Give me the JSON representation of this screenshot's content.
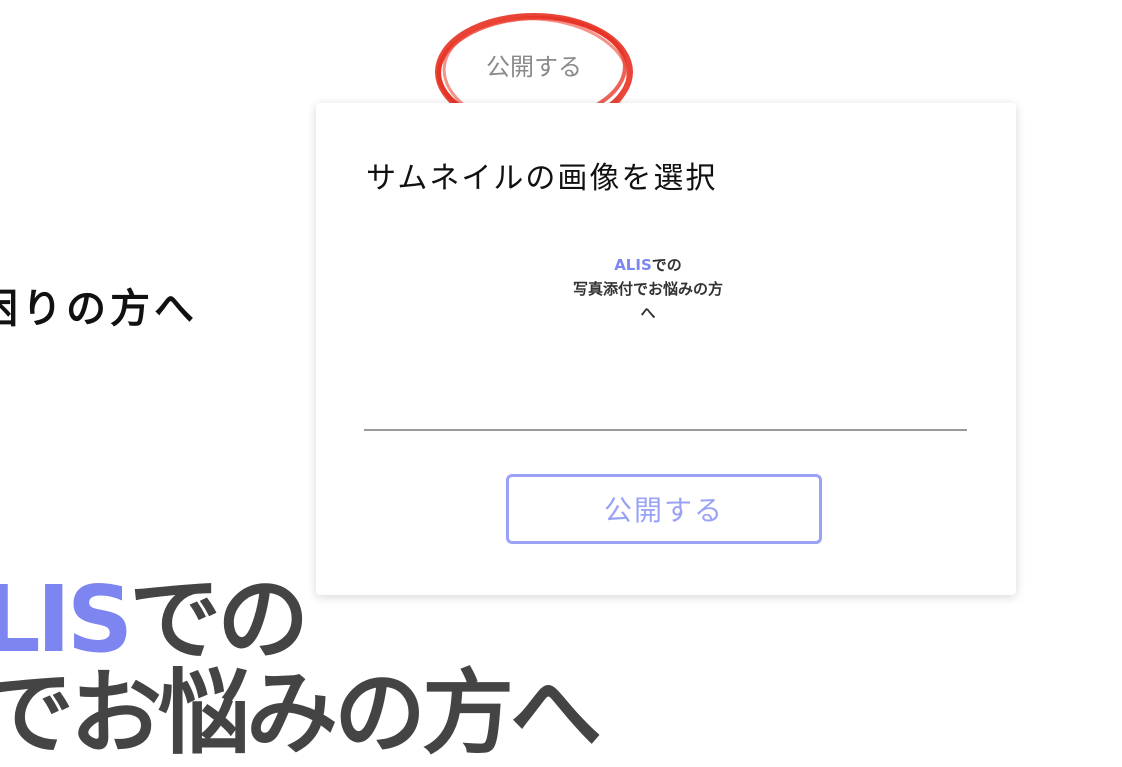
{
  "background": {
    "heading": "困りの方へ",
    "banner": {
      "brand": "LIS",
      "line1_suffix": "での",
      "line2": "でお悩みの方へ"
    }
  },
  "top_publish": {
    "label": "公開する",
    "annotation_color": "#e63022"
  },
  "modal": {
    "title": "サムネイルの画像を選択",
    "thumbnail": {
      "brand": "ALIS",
      "line1_suffix": "での",
      "line2": "写真添付でお悩みの方へ"
    },
    "publish_button": "公開する"
  },
  "colors": {
    "accent": "#9aa2f5",
    "brand": "#7d86f0"
  }
}
